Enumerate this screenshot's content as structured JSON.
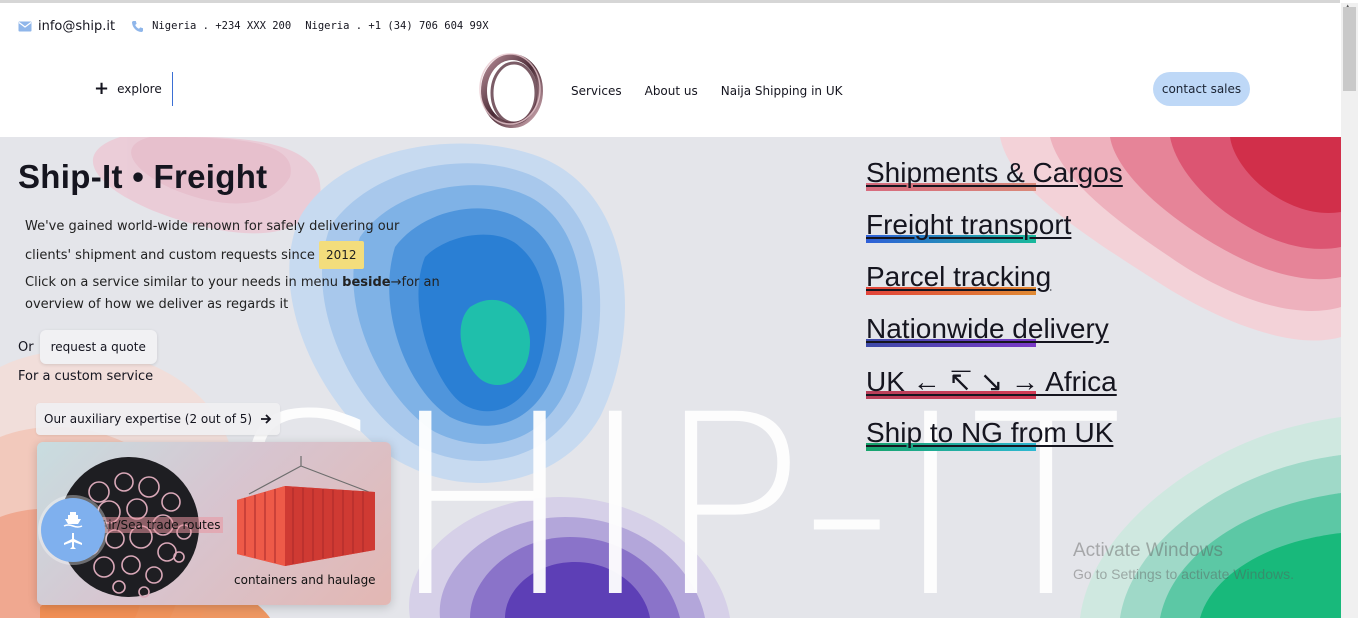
{
  "contact": {
    "email": "info@ship.it",
    "phone1": "Nigeria . +234 XXX 200",
    "phone2": "Nigeria . +1 (34) 706 604 99X"
  },
  "header": {
    "explore_label": "explore",
    "nav": [
      "Services",
      "About us",
      "Naija Shipping in UK"
    ],
    "contact_sales_label": "contact sales"
  },
  "hero": {
    "title": "Ship-It • Freight",
    "intro": "We've gained world-wide renown for safely delivering our clients' shipment and custom requests since",
    "year": "2012",
    "click_pre": "Click on a service similar to your needs in menu",
    "click_bold": "beside",
    "click_post": "→for an overview of how we deliver as regards it",
    "or_label": "Or",
    "quote_label": "request a quote",
    "custom_label": "For a custom service",
    "aux_label": "Our auxiliary expertise (2 out of 5)",
    "watermark": "SHIP-IT"
  },
  "cards": {
    "trade_label": "Air/Sea trade routes",
    "containers_label": "containers and haulage"
  },
  "services": [
    {
      "label": "Shipments & Cargos",
      "color": "#d76b7e",
      "color2": "#d9897a"
    },
    {
      "label": "Freight transport",
      "color": "#2f5fd8",
      "color2": "#19b99c"
    },
    {
      "label": "Parcel tracking",
      "color": "#e2443a",
      "color2": "#e08a34"
    },
    {
      "label": "Nationwide delivery",
      "color": "#3d4aa8",
      "color2": "#7a39c6"
    },
    {
      "label": "UK ← ↸ ↘ → Africa",
      "color": "#b9405a",
      "color2": "#d23b55"
    },
    {
      "label": "Ship to NG from UK",
      "color": "#17a36b",
      "color2": "#2eb8d3"
    }
  ],
  "activate": {
    "line1": "Activate Windows",
    "line2": "Go to Settings to activate Windows."
  },
  "icons": [
    "mail-icon",
    "phone-icon",
    "plus-icon",
    "arrow-right-icon",
    "ship-icon",
    "plane-icon"
  ]
}
